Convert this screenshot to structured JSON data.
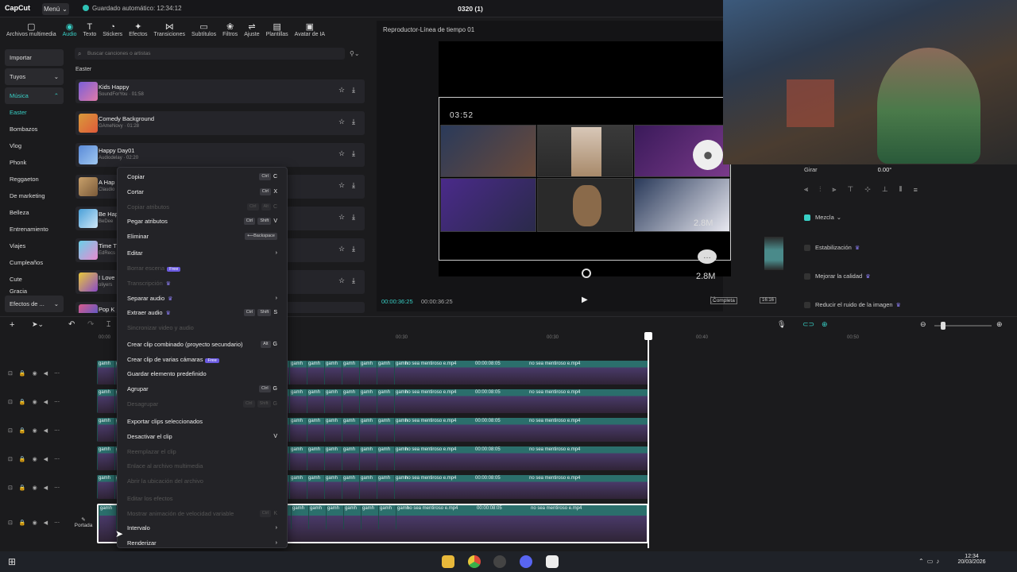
{
  "titlebar": {
    "logo": "CapCut",
    "menu": "Menú",
    "autosave": "Guardado automático: 12:34:12",
    "project": "0320 (1)"
  },
  "toolbar": {
    "items": [
      "Archivos multimedia",
      "Audio",
      "Texto",
      "Stickers",
      "Efectos",
      "Transiciones",
      "Subtítulos",
      "Filtros",
      "Ajuste",
      "Plantillas",
      "Avatar de IA"
    ]
  },
  "left_nav": {
    "import": "Importar",
    "yours": "Tuyos",
    "music": "Música",
    "items": [
      "Easter",
      "Bombazos",
      "Vlog",
      "Phonk",
      "Reggaeton",
      "De marketing",
      "Belleza",
      "Entrenamiento",
      "Viajes",
      "Cumpleaños",
      "Cute",
      "Gracia"
    ],
    "sound_effects": "Efectos de ..."
  },
  "music": {
    "search_placeholder": "Buscar canciones o artistas",
    "section": "Easter",
    "songs": [
      {
        "name": "Kids Happy",
        "meta": "SoundForYou · 01:58"
      },
      {
        "name": "Comedy Background",
        "meta": "GAmeNovy · 01:28"
      },
      {
        "name": "Happy Day01",
        "meta": "Audiodelay · 02:20"
      },
      {
        "name": "A Hap",
        "meta": "Claudio"
      },
      {
        "name": "Be Hap",
        "meta": "BeDee"
      },
      {
        "name": "Time T",
        "meta": "EdRecs"
      },
      {
        "name": "I Love",
        "meta": "oliyers"
      },
      {
        "name": "Pop K",
        "meta": ""
      }
    ]
  },
  "player": {
    "title": "Reproductor-Línea de tiempo 01",
    "overlay_time": "03:52",
    "stat1": "2.8M",
    "stat2": "2.8M",
    "current": "00:00:36:25",
    "total": "00:00:36:25",
    "fit": "Completa",
    "ratio": "16:16"
  },
  "properties": {
    "rotate_label": "Girar",
    "rotate_value": "0.00°",
    "mix": "Mezcla",
    "stabilize": "Estabilización",
    "quality": "Mejorar la calidad",
    "noise": "Reducir el ruido de la imagen"
  },
  "timeline": {
    "ticks": [
      "00:00",
      "00:30",
      "00:30",
      "00:40",
      "00:50"
    ],
    "clip_label": "gamh",
    "clip_name": "no sea mentiroso e.mp4",
    "clip_duration": "00:00:08:05",
    "cover": "Portada"
  },
  "context_menu": [
    {
      "label": "Copiar",
      "keys": [
        "Ctrl"
      ],
      "key": "C",
      "disabled": false
    },
    {
      "label": "Cortar",
      "keys": [
        "Ctrl"
      ],
      "key": "X",
      "disabled": false
    },
    {
      "label": "Copiar atributos",
      "keys": [
        "Ctrl",
        "Alt"
      ],
      "key": "C",
      "disabled": true
    },
    {
      "label": "Pegar atributos",
      "keys": [
        "Ctrl",
        "Shift"
      ],
      "key": "V",
      "disabled": false
    },
    {
      "label": "Eliminar",
      "keys": [
        "⟵Backspace"
      ],
      "key": "",
      "disabled": false
    },
    {
      "label": "Editar",
      "keys": [],
      "key": "›",
      "disabled": false
    },
    {
      "label": "Borrar escena",
      "badge": "Free",
      "keys": [],
      "key": "",
      "disabled": true
    },
    {
      "label": "Transcripción",
      "crown": true,
      "keys": [],
      "key": "",
      "disabled": true
    },
    {
      "label": "Separar audio",
      "crown": true,
      "keys": [],
      "key": "›",
      "disabled": false
    },
    {
      "label": "Extraer audio",
      "crown": true,
      "keys": [
        "Ctrl",
        "Shift"
      ],
      "key": "S",
      "disabled": false
    },
    {
      "label": "Sincronizar video y audio",
      "keys": [],
      "key": "",
      "disabled": true
    },
    {
      "label": "Crear clip combinado (proyecto secundario)",
      "keys": [
        "Alt"
      ],
      "key": "G",
      "disabled": false
    },
    {
      "label": "Crear clip de varias cámaras",
      "badge": "Free",
      "keys": [],
      "key": "",
      "disabled": false
    },
    {
      "label": "Guardar elemento predefinido",
      "keys": [],
      "key": "",
      "disabled": false
    },
    {
      "label": "Agrupar",
      "keys": [
        "Ctrl"
      ],
      "key": "G",
      "disabled": false
    },
    {
      "label": "Desagrupar",
      "keys": [
        "Ctrl",
        "Shift"
      ],
      "key": "G",
      "disabled": true
    },
    {
      "label": "Exportar clips seleccionados",
      "keys": [],
      "key": "",
      "disabled": false
    },
    {
      "label": "Desactivar el clip",
      "keys": [],
      "key": "V",
      "disabled": false
    },
    {
      "label": "Reemplazar el clip",
      "keys": [],
      "key": "",
      "disabled": true
    },
    {
      "label": "Enlace al archivo multimedia",
      "keys": [],
      "key": "",
      "disabled": true
    },
    {
      "label": "Abrir la ubicación del archivo",
      "keys": [],
      "key": "",
      "disabled": true
    },
    {
      "label": "Editar los efectos",
      "keys": [],
      "key": "",
      "disabled": true
    },
    {
      "label": "Mostrar animación de velocidad variable",
      "keys": [
        "Ctrl"
      ],
      "key": "K",
      "disabled": true
    },
    {
      "label": "Intervalo",
      "keys": [],
      "key": "›",
      "disabled": false
    },
    {
      "label": "Renderizar",
      "keys": [],
      "key": "›",
      "disabled": false
    }
  ],
  "taskbar": {
    "time": "12:34",
    "date": "20/03/2026"
  },
  "colors": {
    "accent": "#38d0c6",
    "clip": "#2b6f6c",
    "premium": "#6a5ae0"
  }
}
